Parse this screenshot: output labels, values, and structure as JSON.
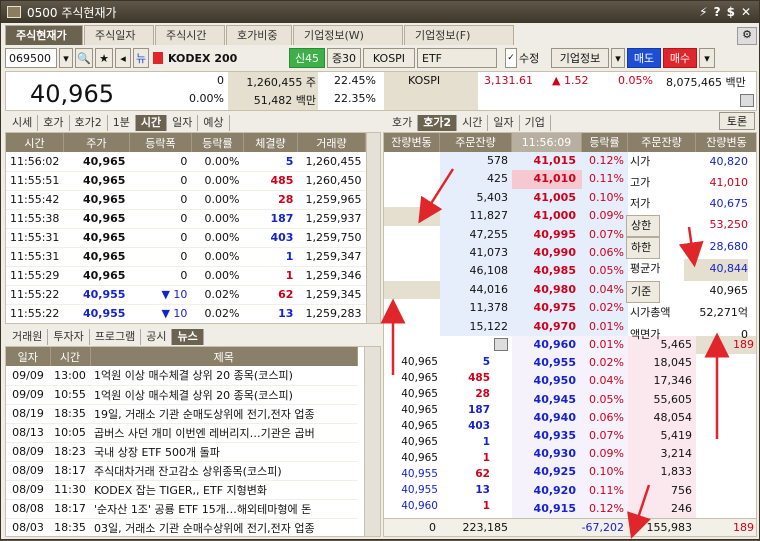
{
  "window": {
    "title": "0500 주식현재가",
    "controls": [
      "⚡",
      "?",
      "$",
      "✕"
    ]
  },
  "tabs": [
    {
      "label": "주식현재가",
      "on": true
    },
    {
      "label": "주식일자"
    },
    {
      "label": "주식시간"
    },
    {
      "label": "호가비중"
    },
    {
      "label": "기업정보(W)"
    },
    {
      "label": "기업정보(F)"
    }
  ],
  "toolbar": {
    "code": "069500",
    "stock": "KODEX 200",
    "new_label": "뉴",
    "badge1": "신45",
    "badge2": "증30",
    "market": "KOSPI",
    "type": "ETF",
    "chk": "수정",
    "info": "기업정보",
    "buy": "매도",
    "sell": "매수"
  },
  "summary": {
    "price": "40,965",
    "vol_change": "0",
    "change_pct": "0.00%",
    "volume": "1,260,455 주",
    "amount": "51,482 백만",
    "turnover": "22.45%",
    "turnover2": "22.35%",
    "idx_name": "KOSPI",
    "idx_val": "3,131.61",
    "idx_chg": "▲ 1.52",
    "idx_pct": "0.05%",
    "idx_amt": "8,075,465 백만"
  },
  "left_tabs": [
    "시세",
    "호가",
    "호가2",
    "1분",
    "시간",
    "일자",
    "예상"
  ],
  "time_header": [
    "시간",
    "주가",
    "등락폭",
    "등락률",
    "체결량",
    "거래량"
  ],
  "time_rows": [
    [
      "11:56:02",
      "40,965",
      "0",
      "0.00%",
      "5",
      "1,260,455",
      "b"
    ],
    [
      "11:55:51",
      "40,965",
      "0",
      "0.00%",
      "485",
      "1,260,450",
      "r"
    ],
    [
      "11:55:42",
      "40,965",
      "0",
      "0.00%",
      "28",
      "1,259,965",
      "r"
    ],
    [
      "11:55:38",
      "40,965",
      "0",
      "0.00%",
      "187",
      "1,259,937",
      "b"
    ],
    [
      "11:55:31",
      "40,965",
      "0",
      "0.00%",
      "403",
      "1,259,750",
      "b"
    ],
    [
      "11:55:31",
      "40,965",
      "0",
      "0.00%",
      "1",
      "1,259,347",
      "b"
    ],
    [
      "11:55:29",
      "40,965",
      "0",
      "0.00%",
      "1",
      "1,259,346",
      "r"
    ],
    [
      "11:55:22",
      "40,955",
      "▼ 10",
      "0.02%",
      "62",
      "1,259,345",
      "r"
    ],
    [
      "11:55:22",
      "40,955",
      "▼ 10",
      "0.02%",
      "13",
      "1,259,283",
      "b"
    ]
  ],
  "news_tabs": [
    "거래원",
    "투자자",
    "프로그램",
    "공시",
    "뉴스"
  ],
  "news_header": [
    "일자",
    "시간",
    "제목"
  ],
  "news_rows": [
    [
      "09/09",
      "13:00",
      "1억원 이상 매수체결 상위 20 종목(코스피)"
    ],
    [
      "09/09",
      "10:55",
      "1억원 이상 매수체결 상위 20 종목(코스피)"
    ],
    [
      "08/19",
      "18:35",
      "19일, 거래소 기관 순매도상위에 전기,전자 업종"
    ],
    [
      "08/13",
      "10:05",
      "곱버스 사던 개미 이번엔 레버리지…기관은 곱버"
    ],
    [
      "08/09",
      "18:23",
      "국내 상장 ETF 500개 돌파"
    ],
    [
      "08/09",
      "18:17",
      "주식대차거래 잔고감소 상위종목(코스피)"
    ],
    [
      "08/09",
      "11:30",
      "KODEX 잡는 TIGER,, ETF 지형변화"
    ],
    [
      "08/08",
      "18:17",
      "'순자산 1조' 공룡 ETF 15개…해외테마형에 돈"
    ],
    [
      "08/03",
      "18:35",
      "03일, 거래소 기관 순매수상위에 전기,전자 업종"
    ]
  ],
  "right_tabs": [
    "호가",
    "호가2",
    "시간",
    "일자",
    "기업"
  ],
  "toron": "토론",
  "ob_header": [
    "잔량변동",
    "주문잔량",
    "11:56:09",
    "등락률",
    "주문잔량",
    "잔량변동"
  ],
  "asks": [
    [
      "578",
      "41,015",
      "0.12%"
    ],
    [
      "425",
      "41,010",
      "0.11%"
    ],
    [
      "5,403",
      "41,005",
      "0.10%"
    ],
    [
      "11,827",
      "41,000",
      "0.09%"
    ],
    [
      "47,255",
      "40,995",
      "0.07%"
    ],
    [
      "41,073",
      "40,990",
      "0.06%"
    ],
    [
      "46,108",
      "40,985",
      "0.05%"
    ],
    [
      "44,016",
      "40,980",
      "0.04%"
    ],
    [
      "11,378",
      "40,975",
      "0.02%"
    ],
    [
      "15,122",
      "40,970",
      "0.01%"
    ]
  ],
  "bids": [
    [
      "40,960",
      "0.01%",
      "5,465",
      "189"
    ],
    [
      "40,955",
      "0.02%",
      "18,045",
      ""
    ],
    [
      "40,950",
      "0.04%",
      "17,346",
      ""
    ],
    [
      "40,945",
      "0.05%",
      "55,605",
      ""
    ],
    [
      "40,940",
      "0.06%",
      "48,054",
      ""
    ],
    [
      "40,935",
      "0.07%",
      "5,419",
      ""
    ],
    [
      "40,930",
      "0.09%",
      "3,214",
      ""
    ],
    [
      "40,925",
      "0.10%",
      "1,833",
      ""
    ],
    [
      "40,920",
      "0.11%",
      "756",
      ""
    ],
    [
      "40,915",
      "0.12%",
      "246",
      ""
    ]
  ],
  "info": [
    [
      "시가",
      "40,820",
      "b"
    ],
    [
      "고가",
      "41,010",
      "r"
    ],
    [
      "저가",
      "40,675",
      "b"
    ],
    [
      "상한",
      "53,250",
      "r"
    ],
    [
      "하한",
      "28,680",
      "b"
    ],
    [
      "평균가",
      "40,844",
      "b"
    ],
    [
      "기준",
      "40,965",
      ""
    ],
    [
      "시가총액",
      "52,271억",
      ""
    ],
    [
      "액면가",
      "0",
      ""
    ]
  ],
  "ticks": [
    [
      "40,965",
      "5",
      "b"
    ],
    [
      "40,965",
      "485",
      "r"
    ],
    [
      "40,965",
      "28",
      "r"
    ],
    [
      "40,965",
      "187",
      "b"
    ],
    [
      "40,965",
      "403",
      "b"
    ],
    [
      "40,965",
      "1",
      "b"
    ],
    [
      "40,965",
      "1",
      "r"
    ],
    [
      "40,955",
      "62",
      "r"
    ],
    [
      "40,955",
      "13",
      "b"
    ],
    [
      "40,960",
      "1",
      "r"
    ]
  ],
  "ob_footer": [
    "0",
    "223,185",
    "-67,202",
    "155,983",
    "189"
  ]
}
